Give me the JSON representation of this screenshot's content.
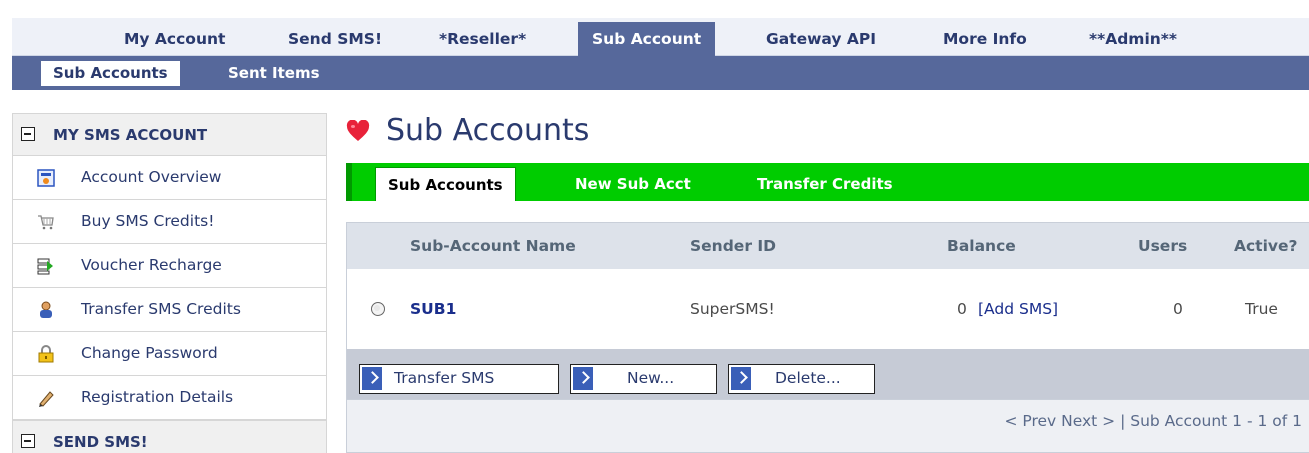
{
  "top_nav": {
    "items": [
      {
        "label": "My Account",
        "active": false
      },
      {
        "label": "Send SMS!",
        "active": false
      },
      {
        "label": "*Reseller*",
        "active": false
      },
      {
        "label": "Sub Account",
        "active": true
      },
      {
        "label": "Gateway API",
        "active": false
      },
      {
        "label": "More Info",
        "active": false
      },
      {
        "label": "**Admin**",
        "active": false
      }
    ]
  },
  "sub_nav": {
    "items": [
      {
        "label": "Sub Accounts",
        "active": true
      },
      {
        "label": "Sent Items",
        "active": false
      }
    ]
  },
  "sidebar": {
    "sections": [
      {
        "title": "MY SMS ACCOUNT",
        "items": [
          {
            "label": "Account Overview",
            "icon": "report-icon"
          },
          {
            "label": "Buy SMS Credits!",
            "icon": "cart-icon"
          },
          {
            "label": "Voucher Recharge",
            "icon": "voucher-icon"
          },
          {
            "label": "Transfer SMS Credits",
            "icon": "user-icon"
          },
          {
            "label": "Change Password",
            "icon": "lock-icon"
          },
          {
            "label": "Registration Details",
            "icon": "pencil-icon"
          }
        ]
      },
      {
        "title": "SEND SMS!",
        "items": []
      }
    ]
  },
  "page": {
    "title": "Sub Accounts",
    "title_icon": "heart-icon"
  },
  "tabs": [
    {
      "label": "Sub Accounts",
      "active": true
    },
    {
      "label": "New Sub Acct",
      "active": false
    },
    {
      "label": "Transfer Credits",
      "active": false
    }
  ],
  "table": {
    "columns": [
      "Sub-Account Name",
      "Sender ID",
      "Balance",
      "Users",
      "Active?"
    ],
    "rows": [
      {
        "name": "SUB1",
        "sender_id": "SuperSMS!",
        "balance": "0",
        "add_sms": "[Add SMS]",
        "users": "0",
        "active": "True"
      }
    ]
  },
  "buttons": {
    "transfer": "Transfer SMS",
    "new": "New...",
    "delete": "Delete..."
  },
  "pager": {
    "text": "< Prev Next > | Sub Account 1 - 1 of 1"
  },
  "colors": {
    "nav_bar": "#56689b",
    "tab_bar": "#00cc00",
    "link": "#1a2e8c",
    "heart": "#e8223a"
  }
}
